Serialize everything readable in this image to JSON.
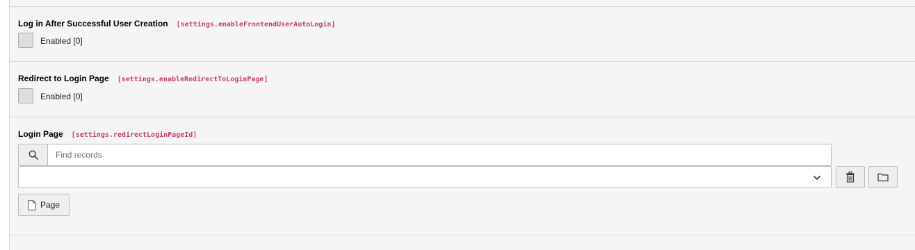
{
  "fields": [
    {
      "title": "Log in After Successful User Creation",
      "code": "[settings.enableFrontendUserAutoLogin]",
      "checkbox_label": "Enabled [0]"
    },
    {
      "title": "Redirect to Login Page",
      "code": "[settings.enableRedirectToLoginPage]",
      "checkbox_label": "Enabled [0]"
    }
  ],
  "login_page": {
    "title": "Login Page",
    "code": "[settings.redirectLoginPageId]",
    "search_placeholder": "Find records",
    "selected_value": "",
    "page_button_label": "Page"
  },
  "icons": {
    "search": "search-icon",
    "chevron": "chevron-down-icon",
    "delete": "trash-icon",
    "browse": "folder-icon",
    "page": "document-icon"
  },
  "colors": {
    "code_accent": "#c83c78",
    "panel_background": "#f5f5f5"
  }
}
